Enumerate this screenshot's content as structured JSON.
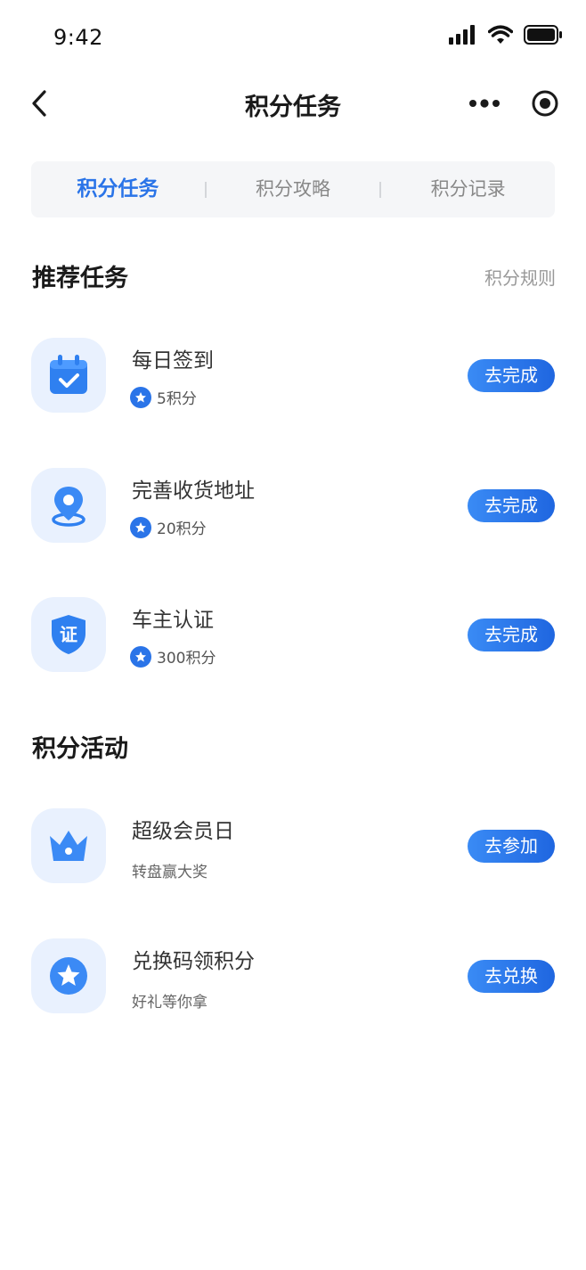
{
  "status_bar": {
    "time": "9:42"
  },
  "navbar": {
    "title": "积分任务",
    "more_icon": "more-dots-icon",
    "target_icon": "target-icon",
    "back_icon": "chevron-left-icon"
  },
  "tabs": [
    {
      "label": "积分任务",
      "active": true
    },
    {
      "label": "积分攻略",
      "active": false
    },
    {
      "label": "积分记录",
      "active": false
    }
  ],
  "recommended": {
    "title": "推荐任务",
    "link": "积分规则",
    "items": [
      {
        "title": "每日签到",
        "sub": "5积分",
        "button": "去完成",
        "icon": "calendar-check-icon"
      },
      {
        "title": "完善收货地址",
        "sub": "20积分",
        "button": "去完成",
        "icon": "location-pin-icon"
      },
      {
        "title": "车主认证",
        "sub": "300积分",
        "button": "去完成",
        "icon": "shield-cert-icon",
        "icon_text": "证"
      }
    ]
  },
  "activities": {
    "title": "积分活动",
    "items": [
      {
        "title": "超级会员日",
        "sub": "转盘赢大奖",
        "button": "去参加",
        "icon": "crown-icon"
      },
      {
        "title": "兑换码领积分",
        "sub": "好礼等你拿",
        "button": "去兑换",
        "icon": "star-badge-icon"
      }
    ]
  },
  "colors": {
    "accent": "#2a74e8",
    "icon_bg": "#e9f1fe",
    "tab_bg": "#f5f6f8"
  }
}
